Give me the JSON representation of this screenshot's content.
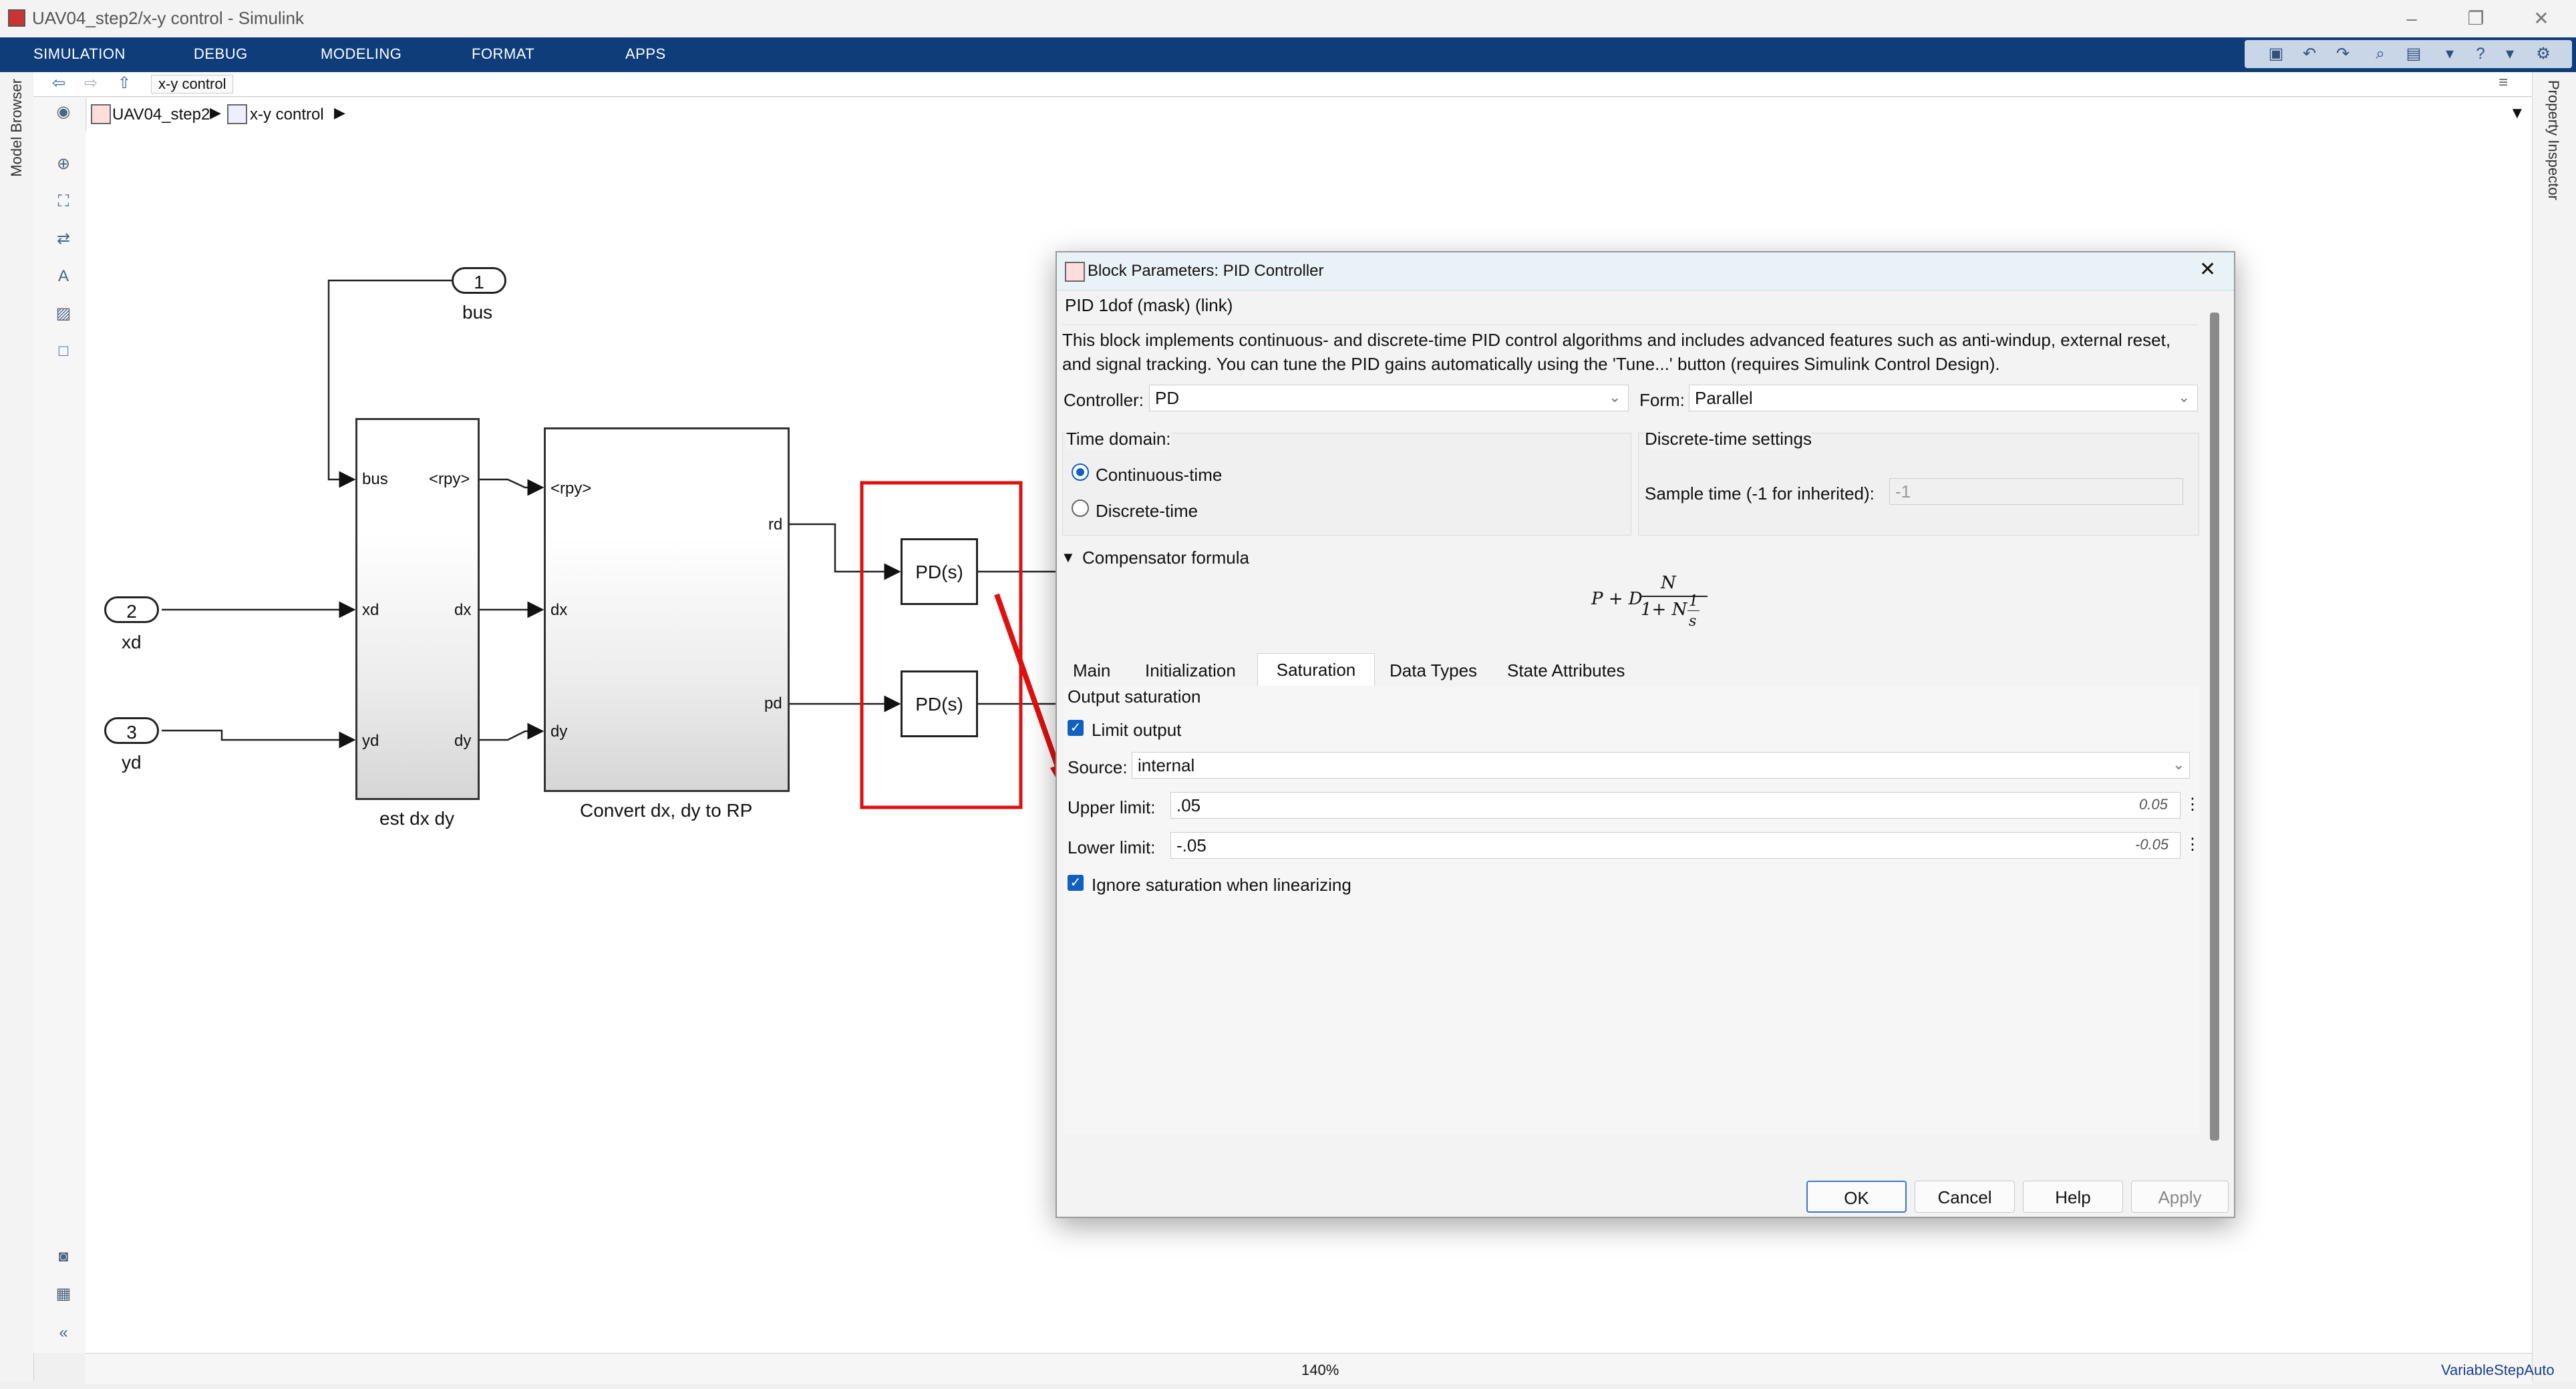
{
  "window": {
    "title": "UAV04_step2/x-y control - Simulink"
  },
  "menu": {
    "items": [
      "SIMULATION",
      "DEBUG",
      "MODELING",
      "FORMAT",
      "APPS"
    ]
  },
  "explorer": {
    "tab_label": "x-y control"
  },
  "breadcrumb": {
    "root": "UAV04_step2",
    "child": "x-y control"
  },
  "side_panels": {
    "left": "Model Browser",
    "right": "Property Inspector"
  },
  "diagram": {
    "ports": [
      {
        "number": "1",
        "name": "bus"
      },
      {
        "number": "2",
        "name": "xd"
      },
      {
        "number": "3",
        "name": "yd"
      }
    ],
    "est_block": {
      "name": "est dx dy",
      "inputs": [
        "bus",
        "xd",
        "yd"
      ],
      "outputs": [
        "<rpy>",
        "dx",
        "dy"
      ]
    },
    "convert_block": {
      "name": "Convert dx, dy to RP",
      "inputs": [
        "<rpy>",
        "dx",
        "dy"
      ],
      "outputs": [
        "rd",
        "pd"
      ]
    },
    "pid_blocks": [
      "PD(s)",
      "PD(s)"
    ]
  },
  "dialog": {
    "title": "Block Parameters: PID Controller",
    "mask_type": "PID 1dof (mask) (link)",
    "description": "This block implements continuous- and discrete-time PID control algorithms and includes advanced features such as anti-windup, external reset, and signal tracking. You can tune the PID gains automatically using the 'Tune...' button (requires Simulink Control Design).",
    "controller_label": "Controller:",
    "controller_value": "PD",
    "form_label": "Form:",
    "form_value": "Parallel",
    "time_domain_label": "Time domain:",
    "time_domain_options": [
      "Continuous-time",
      "Discrete-time"
    ],
    "time_domain_selected": "Continuous-time",
    "discrete_settings_label": "Discrete-time settings",
    "sample_time_label": "Sample time (-1 for inherited):",
    "sample_time_value": "-1",
    "compensator_label": "Compensator formula",
    "formula": {
      "lead": "P + D",
      "num": "N",
      "den_lead": "1+ N",
      "den_num": "1",
      "den_den": "s"
    },
    "tabs": [
      "Main",
      "Initialization",
      "Saturation",
      "Data Types",
      "State Attributes"
    ],
    "active_tab": "Saturation",
    "saturation": {
      "section_label": "Output saturation",
      "limit_output_label": "Limit output",
      "limit_output_checked": true,
      "source_label": "Source:",
      "source_value": "internal",
      "upper_label": "Upper limit:",
      "upper_value": ".05",
      "upper_eval": "0.05",
      "lower_label": "Lower limit:",
      "lower_value": "-.05",
      "lower_eval": "-0.05",
      "ignore_label": "Ignore saturation when linearizing",
      "ignore_checked": true
    },
    "buttons": {
      "ok": "OK",
      "cancel": "Cancel",
      "help": "Help",
      "apply": "Apply"
    }
  },
  "status": {
    "zoom": "140%",
    "solver": "VariableStepAuto"
  },
  "colors": {
    "menubar": "#0f3d7a",
    "annotation_red": "#e01010",
    "accent": "#1060c0"
  }
}
